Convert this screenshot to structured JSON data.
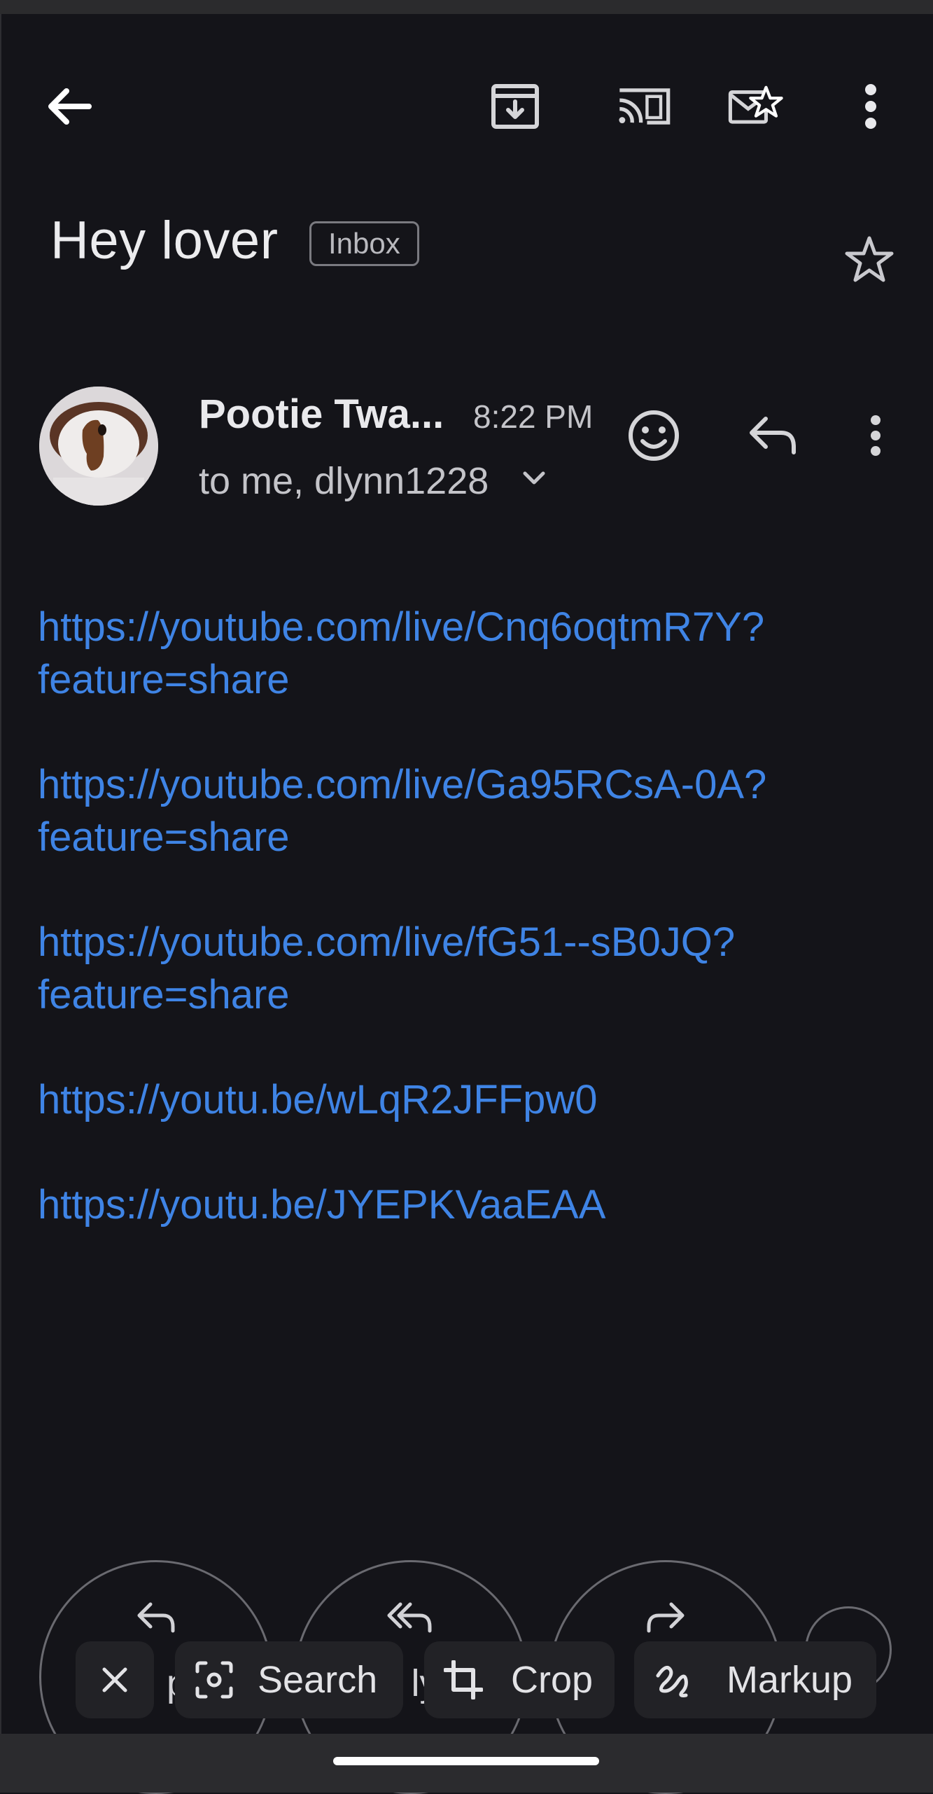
{
  "header": {
    "icons": [
      "back-arrow-icon",
      "archive-icon",
      "cast-icon",
      "mark-unread-icon",
      "overflow-menu-icon"
    ]
  },
  "email": {
    "subject": "Hey lover",
    "label_badge": "Inbox",
    "sender_name": "Pootie Twa...",
    "time": "8:22 PM",
    "recipients": "to me, dlynn1228",
    "links": [
      {
        "line1": "https://youtube.com/live/Cnq6oqtmR7Y?",
        "line2": "feature=share"
      },
      {
        "line1": "https://youtube.com/live/Ga95RCsA-0A?",
        "line2": "feature=share"
      },
      {
        "line1": "https://youtube.com/live/fG51--sB0JQ?",
        "line2": "feature=share"
      },
      {
        "line1": "https://youtu.be/wLqR2JFFpw0",
        "line2": ""
      },
      {
        "line1": "https://youtu.be/JYEPKVaaEAA",
        "line2": ""
      }
    ]
  },
  "bottom_actions": {
    "reply_partial": "p",
    "reply_all_partial": "ly",
    "forward_partial": "o"
  },
  "screenshot_toolbar": {
    "search": "Search",
    "crop": "Crop",
    "markup": "Markup"
  },
  "colors": {
    "background": "#141419",
    "link": "#3f84e5",
    "text": "#e6e6e8"
  }
}
